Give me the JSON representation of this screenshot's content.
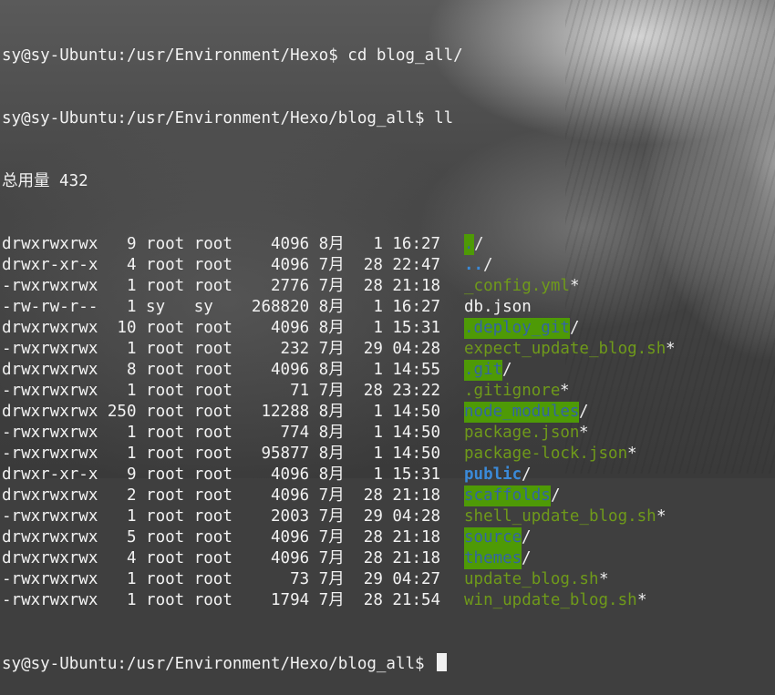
{
  "prompt_1": "sy@sy-Ubuntu:/usr/Environment/Hexo$ cd blog_all/",
  "prompt_2": "sy@sy-Ubuntu:/usr/Environment/Hexo/blog_all$ ll",
  "total": "总用量 432",
  "entries": [
    {
      "perm": "drwxrwxrwx",
      "links": "9",
      "owner": "root",
      "group": "root",
      "size": "4096",
      "month": "8月",
      "day": "1",
      "time": "16:27",
      "name": ".",
      "suffix": "/"
    },
    {
      "perm": "drwxr-xr-x",
      "links": "4",
      "owner": "root",
      "group": "root",
      "size": "4096",
      "month": "7月",
      "day": "28",
      "time": "22:47",
      "name": "..",
      "suffix": "/"
    },
    {
      "perm": "-rwxrwxrwx",
      "links": "1",
      "owner": "root",
      "group": "root",
      "size": "2776",
      "month": "7月",
      "day": "28",
      "time": "21:18",
      "name": "_config.yml",
      "suffix": "*"
    },
    {
      "perm": "-rw-rw-r--",
      "links": "1",
      "owner": "sy",
      "group": "sy",
      "size": "268820",
      "month": "8月",
      "day": "1",
      "time": "16:27",
      "name": "db.json",
      "suffix": ""
    },
    {
      "perm": "drwxrwxrwx",
      "links": "10",
      "owner": "root",
      "group": "root",
      "size": "4096",
      "month": "8月",
      "day": "1",
      "time": "15:31",
      "name": ".deploy_git",
      "suffix": "/"
    },
    {
      "perm": "-rwxrwxrwx",
      "links": "1",
      "owner": "root",
      "group": "root",
      "size": "232",
      "month": "7月",
      "day": "29",
      "time": "04:28",
      "name": "expect_update_blog.sh",
      "suffix": "*"
    },
    {
      "perm": "drwxrwxrwx",
      "links": "8",
      "owner": "root",
      "group": "root",
      "size": "4096",
      "month": "8月",
      "day": "1",
      "time": "14:55",
      "name": ".git",
      "suffix": "/"
    },
    {
      "perm": "-rwxrwxrwx",
      "links": "1",
      "owner": "root",
      "group": "root",
      "size": "71",
      "month": "7月",
      "day": "28",
      "time": "23:22",
      "name": ".gitignore",
      "suffix": "*"
    },
    {
      "perm": "drwxrwxrwx",
      "links": "250",
      "owner": "root",
      "group": "root",
      "size": "12288",
      "month": "8月",
      "day": "1",
      "time": "14:50",
      "name": "node_modules",
      "suffix": "/"
    },
    {
      "perm": "-rwxrwxrwx",
      "links": "1",
      "owner": "root",
      "group": "root",
      "size": "774",
      "month": "8月",
      "day": "1",
      "time": "14:50",
      "name": "package.json",
      "suffix": "*"
    },
    {
      "perm": "-rwxrwxrwx",
      "links": "1",
      "owner": "root",
      "group": "root",
      "size": "95877",
      "month": "8月",
      "day": "1",
      "time": "14:50",
      "name": "package-lock.json",
      "suffix": "*"
    },
    {
      "perm": "drwxr-xr-x",
      "links": "9",
      "owner": "root",
      "group": "root",
      "size": "4096",
      "month": "8月",
      "day": "1",
      "time": "15:31",
      "name": "public",
      "suffix": "/"
    },
    {
      "perm": "drwxrwxrwx",
      "links": "2",
      "owner": "root",
      "group": "root",
      "size": "4096",
      "month": "7月",
      "day": "28",
      "time": "21:18",
      "name": "scaffolds",
      "suffix": "/"
    },
    {
      "perm": "-rwxrwxrwx",
      "links": "1",
      "owner": "root",
      "group": "root",
      "size": "2003",
      "month": "7月",
      "day": "29",
      "time": "04:28",
      "name": "shell_update_blog.sh",
      "suffix": "*"
    },
    {
      "perm": "drwxrwxrwx",
      "links": "5",
      "owner": "root",
      "group": "root",
      "size": "4096",
      "month": "7月",
      "day": "28",
      "time": "21:18",
      "name": "source",
      "suffix": "/"
    },
    {
      "perm": "drwxrwxrwx",
      "links": "4",
      "owner": "root",
      "group": "root",
      "size": "4096",
      "month": "7月",
      "day": "28",
      "time": "21:18",
      "name": "themes",
      "suffix": "/"
    },
    {
      "perm": "-rwxrwxrwx",
      "links": "1",
      "owner": "root",
      "group": "root",
      "size": "73",
      "month": "7月",
      "day": "29",
      "time": "04:27",
      "name": "update_blog.sh",
      "suffix": "*"
    },
    {
      "perm": "-rwxrwxrwx",
      "links": "1",
      "owner": "root",
      "group": "root",
      "size": "1794",
      "month": "7月",
      "day": "28",
      "time": "21:54",
      "name": "win_update_blog.sh",
      "suffix": "*"
    }
  ],
  "prompt_final": "sy@sy-Ubuntu:/usr/Environment/Hexo/blog_all$ ",
  "colors": {
    "dir_highlight_bg": "#4e9a06",
    "dir_text": "#3465a4",
    "exec_text": "#6f9a1a",
    "public_dir_text": "#3b8ad8"
  }
}
